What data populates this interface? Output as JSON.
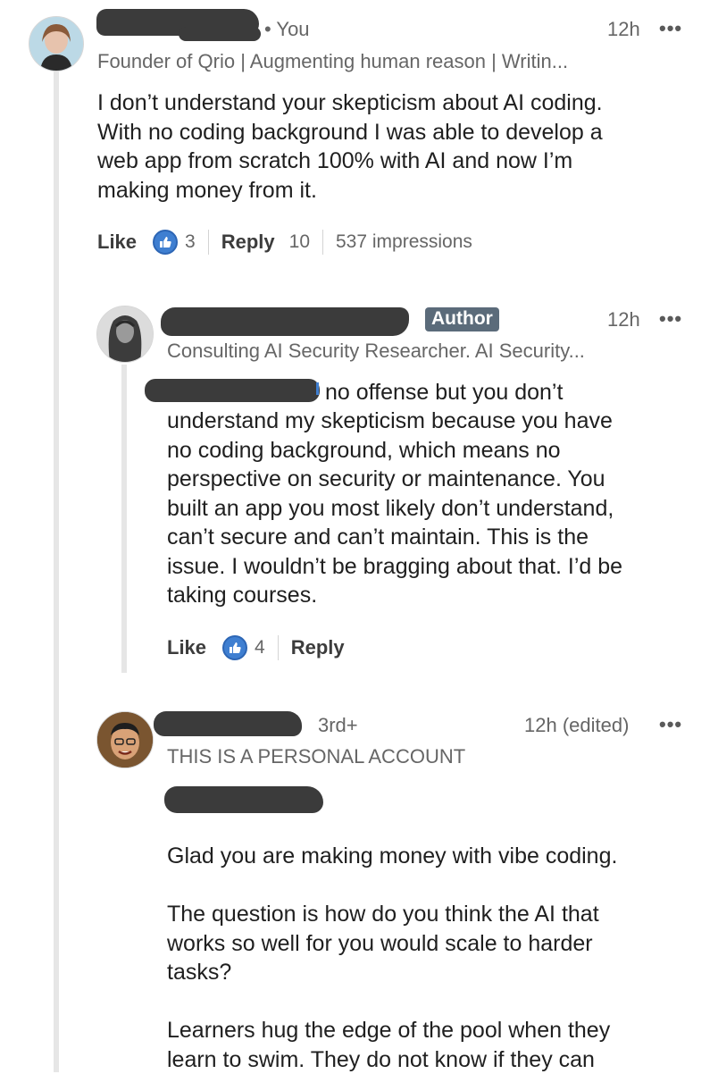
{
  "comments": [
    {
      "you_tag": "• You",
      "time": "12h",
      "menu": "•••",
      "headline": "Founder of Qrio | Augmenting human reason | Writin...",
      "body": "I don’t understand your skepticism about AI coding.\nWith no coding background I was able to develop a\nweb app from scratch 100% with AI and now I’m\nmaking money from it.",
      "like_label": "Like",
      "like_count": "3",
      "reply_label": "Reply",
      "reply_count": "10",
      "impressions": "537 impressions"
    },
    {
      "badge": "Author",
      "time": "12h",
      "menu": "•••",
      "headline": "Consulting AI Security Researcher. AI Security...",
      "body_first": "no offense but you don’t",
      "body": "understand my skepticism because you have\nno coding background, which means no\nperspective on security or maintenance. You\nbuilt an app you most likely don’t understand,\ncan’t secure and can’t maintain. This is the\nissue. I wouldn’t be bragging about that. I’d be\ntaking courses.",
      "like_label": "Like",
      "like_count": "4",
      "reply_label": "Reply"
    },
    {
      "degree": "3rd+",
      "time": "12h (edited)",
      "menu": "•••",
      "headline": "THIS IS A PERSONAL ACCOUNT",
      "para1": "Glad you are making money with vibe coding.",
      "para2": "The question is how do you think the AI that\nworks so well for you would scale to harder\ntasks?",
      "para3": "Learners hug the edge of the pool when they\nlearn to swim. They do not know if they can"
    }
  ],
  "colors": {
    "like_blue": "#3f7fd1",
    "badge_bg": "#5b6b7a",
    "redaction": "#3b3b3b"
  }
}
